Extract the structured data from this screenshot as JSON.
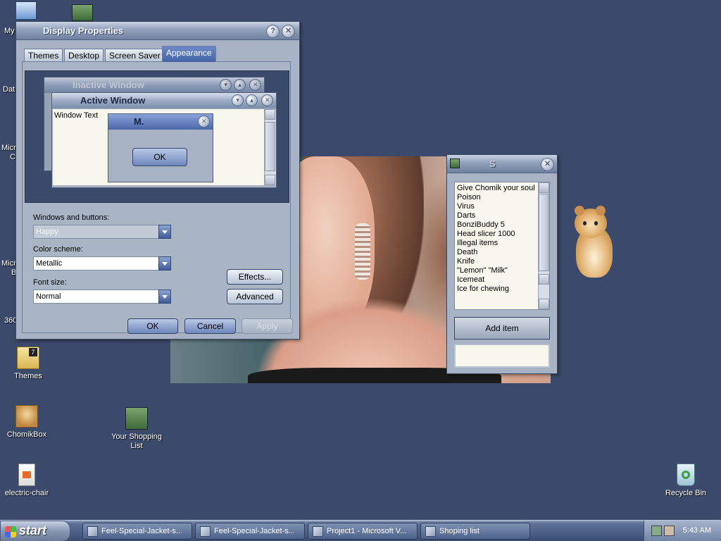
{
  "desktop": {
    "icons": {
      "my_computer": "My",
      "data": "Dat",
      "micro1": "Micr",
      "micro1b": "C",
      "micro2": "Micr",
      "micro2b": "B",
      "app360": "360",
      "themes": "Themes",
      "chomikbox": "ChomikBox",
      "shopping": "Your Shopping List",
      "electric": "electric-chair",
      "recycle": "Recycle Bin"
    }
  },
  "display_properties": {
    "title": "Display Properties",
    "tabs": [
      "Themes",
      "Desktop",
      "Screen Saver",
      "Appearance"
    ],
    "active_tab": "Appearance",
    "preview": {
      "inactive_title": "Inactive Window",
      "active_title": "Active Window",
      "window_text": "Window Text",
      "message_title": "M.",
      "ok": "OK"
    },
    "windows_buttons_label": "Windows and buttons:",
    "windows_buttons_value": "Happy",
    "color_scheme_label": "Color scheme:",
    "color_scheme_value": "Metallic",
    "font_size_label": "Font size:",
    "font_size_value": "Normal",
    "effects": "Effects...",
    "advanced": "Advanced",
    "ok": "OK",
    "cancel": "Cancel",
    "apply": "Apply"
  },
  "shopping_window": {
    "title": "S",
    "items": [
      "Give Chomik your soul",
      "Poison",
      "Virus",
      "Darts",
      "BonziBuddy 5",
      "Head slicer 1000",
      "Illegal items",
      "Death",
      "Knife",
      "\"Lemon\" \"Milk\"",
      "Icemeat",
      "Ice for chewing"
    ],
    "add_item": "Add item",
    "input_value": ""
  },
  "taskbar": {
    "start": "start",
    "tasks": [
      "Feel-Special-Jacket-s...",
      "Feel-Special-Jacket-s...",
      "Project1 - Microsoft V...",
      "Shoping list"
    ],
    "clock": "5:43 AM"
  }
}
